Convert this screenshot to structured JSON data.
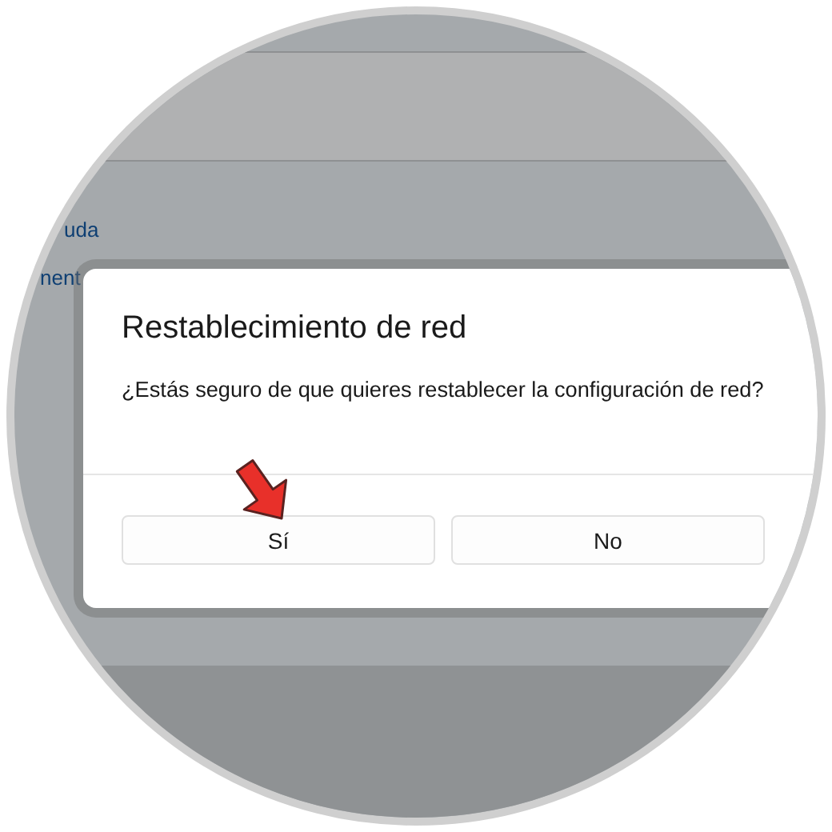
{
  "background_links": [
    {
      "text": "uda"
    },
    {
      "text": "nent"
    }
  ],
  "dialog": {
    "title": "Restablecimiento de red",
    "message": "¿Estás seguro de que quieres restablecer la configuración de red?",
    "buttons": [
      {
        "label": "Sí"
      },
      {
        "label": "No"
      }
    ]
  }
}
